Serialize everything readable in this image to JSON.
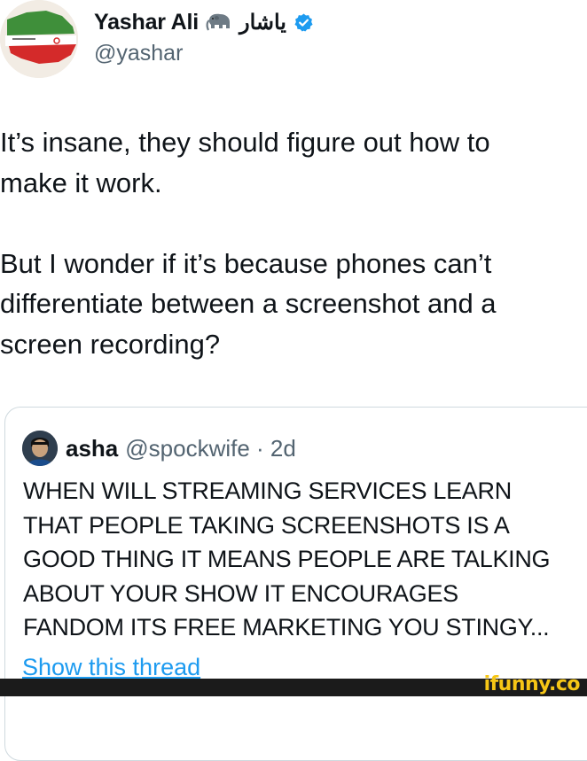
{
  "author": {
    "display_name": "Yashar Ali",
    "arabic_name": "یاشار",
    "handle": "@yashar",
    "badge_icon": "elephant-icon",
    "verified_icon": "verified-badge-icon",
    "verified_color": "#1d9bf0"
  },
  "tweet": {
    "text": "It’s insane, they should figure out how to\nmake it work.\n\nBut I wonder if it’s because phones can’t\ndifferentiate between a screenshot and a\nscreen recording?"
  },
  "quoted_tweet": {
    "name": "asha",
    "handle_time": "@spockwife · 2d",
    "text": "WHEN WILL STREAMING SERVICES LEARN\nTHAT PEOPLE TAKING SCREENSHOTS IS A\nGOOD THING IT MEANS PEOPLE ARE TALKING\nABOUT YOUR SHOW IT ENCOURAGES\nFANDOM ITS FREE MARKETING YOU STINGY...",
    "show_thread": "Show this thread"
  },
  "watermark": {
    "text": "ifunny.co",
    "color": "#f6c616"
  },
  "colors": {
    "text_primary": "#0f1419",
    "text_secondary": "#536471",
    "link": "#1d9bf0",
    "border": "#cfd9de"
  }
}
